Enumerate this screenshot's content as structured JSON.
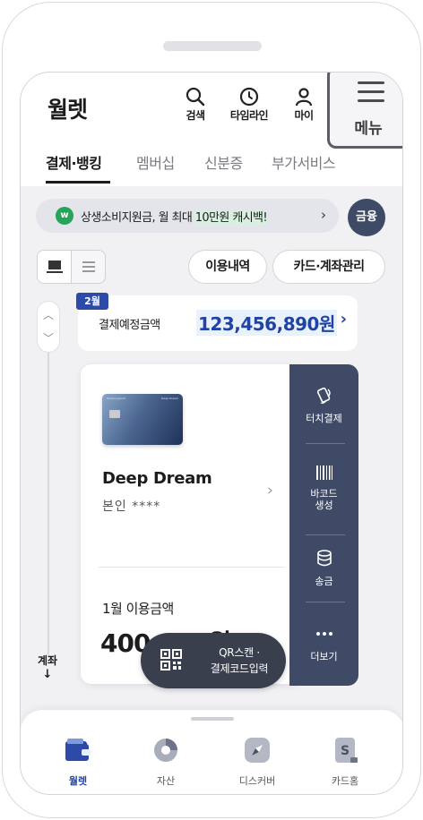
{
  "header": {
    "title": "월렛",
    "search_label": "검색",
    "timeline_label": "타임라인",
    "my_label": "마이",
    "menu_label": "메뉴"
  },
  "tabs": [
    "결제·뱅킹",
    "멤버십",
    "신분증",
    "부가서비스"
  ],
  "active_tab": 0,
  "promo": {
    "logo": "w",
    "text_pre": "상생소비지원금, 월 최대 ",
    "text_hl": "10만원 캐시백!",
    "chevron": "›"
  },
  "finance_button": "금융",
  "actions": {
    "history": "이용내역",
    "manage": "카드·계좌관리"
  },
  "scheduled": {
    "month_badge": "2월",
    "label": "결제예정금액",
    "amount": "123,456,890원",
    "chevron": "›"
  },
  "card": {
    "brand": "SamsungCard",
    "card_print": "Deep Dream",
    "name": "Deep Dream",
    "owner": "본인 ****",
    "usage_label": "1월 이용금액",
    "usage_amount": "400,000원"
  },
  "side_actions": {
    "touch_pay": "터치결제",
    "barcode": "바코드\n생성",
    "transfer": "송금",
    "more": "더보기"
  },
  "qr_button": {
    "line1": "QR스캔 ·",
    "line2": "결제코드입력"
  },
  "account_label": {
    "text": "계좌",
    "arrow": "↓"
  },
  "vertical_nav": {
    "up": "︿",
    "down": "﹀"
  },
  "bottom_nav": [
    "월렛",
    "자산",
    "디스커버",
    "카드홈"
  ],
  "active_nav": 0,
  "colors": {
    "accent": "#2143a3",
    "panel_navy": "#3e4a66",
    "promo_green": "#27a35a",
    "background": "#f1f1f4"
  },
  "icons": [
    "search-icon",
    "clock-icon",
    "person-icon",
    "hamburger-icon",
    "wallet-icon",
    "pie-chart-icon",
    "compass-icon",
    "card-home-icon",
    "nfc-icon",
    "barcode-icon",
    "coin-stack-icon",
    "more-icon",
    "qr-icon"
  ]
}
